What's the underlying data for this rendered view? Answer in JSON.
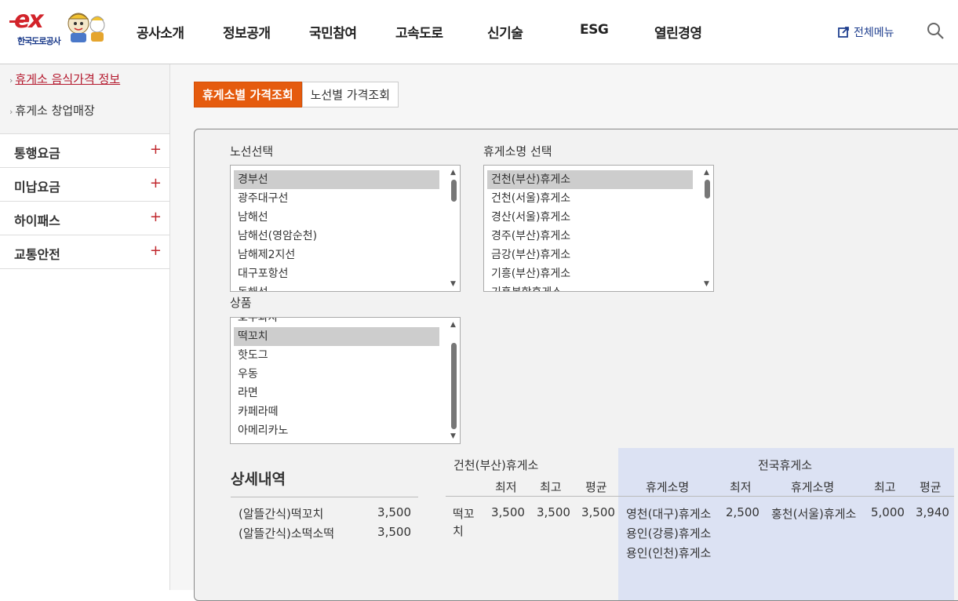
{
  "header": {
    "logo_text": "ex",
    "logo_sub": "한국도로공사",
    "nav": [
      "공사소개",
      "정보공개",
      "국민참여",
      "고속도로",
      "신기술",
      "ESG",
      "열린경영"
    ],
    "all_menu": "전체메뉴"
  },
  "sidebar": {
    "sub_items": [
      {
        "label": "휴게소 음식가격 정보",
        "active": true
      },
      {
        "label": "휴게소 창업매장",
        "active": false
      }
    ],
    "menu": [
      {
        "label": "통행요금"
      },
      {
        "label": "미납요금"
      },
      {
        "label": "하이패스"
      },
      {
        "label": "교통안전"
      }
    ]
  },
  "tabs": {
    "active": "휴게소별 가격조회",
    "inactive": "노선별 가격조회"
  },
  "form": {
    "route_label": "노선선택",
    "routes": [
      "경부선",
      "광주대구선",
      "남해선",
      "남해선(영암순천)",
      "남해제2지선",
      "대구포항선",
      "동해선"
    ],
    "route_selected": "경부선",
    "rest_label": "휴게소명 선택",
    "rest_areas": [
      "건천(부산)휴게소",
      "건천(서울)휴게소",
      "경산(서울)휴게소",
      "경주(부산)휴게소",
      "금강(부산)휴게소",
      "기흥(부산)휴게소",
      "기흥복합휴게소"
    ],
    "rest_selected": "건천(부산)휴게소",
    "product_label": "상품",
    "products": [
      "호두과자",
      "떡꼬치",
      "핫도그",
      "우동",
      "라면",
      "카페라떼",
      "아메리카노"
    ],
    "product_selected": "떡꼬치"
  },
  "detail": {
    "title": "상세내역",
    "items": [
      {
        "name": "(알뜰간식)떡꼬치",
        "price": "3,500"
      },
      {
        "name": "(알뜰간식)소떡소떡",
        "price": "3,500"
      }
    ],
    "rest_name": "건천(부산)휴게소",
    "col_min": "최저",
    "col_max": "최고",
    "col_avg": "평균",
    "natl_title": "전국휴게소",
    "col_natl_name": "휴게소명",
    "row": {
      "product": "떡꼬치",
      "min": "3,500",
      "max": "3,500",
      "avg": "3,500",
      "natl_min_names": [
        "영천(대구)휴게소",
        "용인(강릉)휴게소",
        "용인(인천)휴게소"
      ],
      "natl_min": "2,500",
      "natl_max_name": "홍천(서울)휴게소",
      "natl_max": "5,000",
      "natl_avg": "3,940"
    }
  },
  "colors": {
    "accent": "#e55b0e",
    "brand": "#d2232a",
    "natl_bg": "#dce2f3"
  }
}
